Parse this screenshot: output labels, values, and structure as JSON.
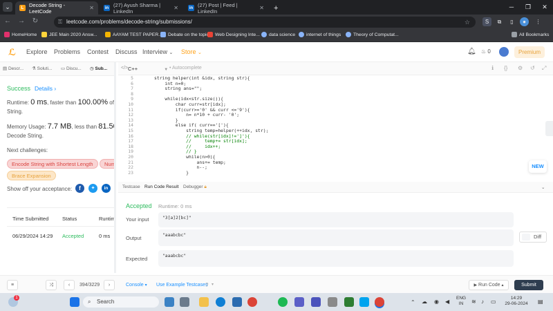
{
  "browser": {
    "tabs": [
      {
        "title": "Decode String - LeetCode"
      },
      {
        "title": "(27) Ayush Sharma | LinkedIn"
      },
      {
        "title": "(27) Post | Feed | LinkedIn"
      }
    ],
    "new_tab": "+",
    "url": "leetcode.com/problems/decode-string/submissions/",
    "bookmarks": [
      "HomeHome",
      "JEE Main 2020 Answ...",
      "AAYAM TEST PAPER...",
      "Debate on the topic...",
      "Web Designing Inte...",
      "data science",
      "internet of things",
      "Theory of Computat..."
    ],
    "all_bookmarks": "All Bookmarks"
  },
  "lc_header": {
    "nav": [
      "Explore",
      "Problems",
      "Contest",
      "Discuss",
      "Interview",
      "Store"
    ],
    "fire_count": "0",
    "premium": "Premium"
  },
  "left": {
    "tabs": [
      "Descr...",
      "Soluti...",
      "Discu...",
      "Sub..."
    ],
    "status": "Success",
    "details": "Details",
    "runtime_prefix": "Runtime:",
    "runtime_value": "0 ms",
    "runtime_mid": ", faster than",
    "runtime_pct": "100.00%",
    "runtime_suffix": "of C++",
    "runtime_line2": "String.",
    "mem_prefix": "Memory Usage:",
    "mem_value": "7.7 MB",
    "mem_mid": ", less than",
    "mem_pct": "81.50%",
    "mem_suffix": "o",
    "mem_line2": "Decode String.",
    "next_label": "Next challenges:",
    "challenges": [
      "Encode String with Shortest Length",
      "Numb",
      "Brace Expansion"
    ],
    "share_label": "Show off your acceptance:",
    "table": {
      "headers": [
        "Time Submitted",
        "Status",
        "Runtim"
      ],
      "row": [
        "06/29/2024 14:29",
        "Accepted",
        "0 ms"
      ]
    }
  },
  "editor": {
    "language": "C++",
    "autocomplete": "Autocomplete",
    "lines": [
      {
        "n": "5",
        "code": "string helper(int &idx, string str){"
      },
      {
        "n": "6",
        "code": "    int n=0;"
      },
      {
        "n": "7",
        "code": "    string ans=\"\";"
      },
      {
        "n": "8",
        "code": ""
      },
      {
        "n": "9",
        "code": "    while(idx<str.size()){"
      },
      {
        "n": "10",
        "code": "        char curr=str[idx];"
      },
      {
        "n": "11",
        "code": "        if(curr>='0' && curr <='9'){"
      },
      {
        "n": "12",
        "code": "            n= n*10 + curr- '0';"
      },
      {
        "n": "13",
        "code": "        }"
      },
      {
        "n": "14",
        "code": "        else if( curr=='['){"
      },
      {
        "n": "15",
        "code": "            string temp=helper(++idx, str);"
      },
      {
        "n": "16",
        "code": "            // while(str[idx]!=']'){",
        "comment": true
      },
      {
        "n": "17",
        "code": "            //     temp+= str[idx];",
        "comment": true
      },
      {
        "n": "18",
        "code": "            //     idx++;",
        "comment": true
      },
      {
        "n": "19",
        "code": "            // }",
        "comment": true
      },
      {
        "n": "20",
        "code": "            while(n>0){"
      },
      {
        "n": "21",
        "code": "                ans+= temp;"
      },
      {
        "n": "22",
        "code": "                n--;"
      },
      {
        "n": "23",
        "code": "            }"
      }
    ],
    "new_badge": "NEW"
  },
  "console": {
    "tabs": [
      "Testcase",
      "Run Code Result",
      "Debugger"
    ],
    "accepted": "Accepted",
    "runtime": "Runtime: 0 ms",
    "input_label": "Your input",
    "input_value": "\"3[a]2[bc]\"",
    "output_label": "Output",
    "output_value": "\"aaabcbc\"",
    "expected_label": "Expected",
    "expected_value": "\"aaabcbc\"",
    "diff": "Diff"
  },
  "bottom": {
    "page": "394/3229",
    "console": "Console",
    "example": "Use Example Testcases",
    "run": "Run Code",
    "submit": "Submit"
  },
  "taskbar": {
    "search": "Search",
    "badge": "1",
    "lang1": "ENG",
    "lang2": "IN",
    "time": "14:29",
    "date": "29-06-2024"
  },
  "colors": {
    "success": "#2cbb5d",
    "accent": "#ffa116",
    "link": "#1a90ff",
    "chip_red": "#f9d4d4",
    "chip_orange": "#fde7c8"
  }
}
